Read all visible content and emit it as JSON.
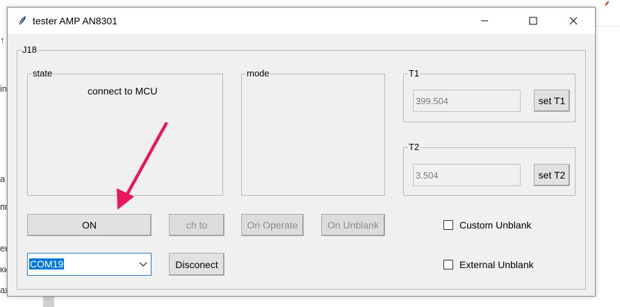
{
  "window": {
    "title": "tester AMP AN8301"
  },
  "groups": {
    "main": "J18",
    "state": "state",
    "mode": "mode",
    "t1": "T1",
    "t2": "T2"
  },
  "state_text": "connect to MCU",
  "t1": {
    "value": "399.504",
    "button": "set T1"
  },
  "t2": {
    "value": "3.504",
    "button": "set T2"
  },
  "buttons": {
    "on": "ON",
    "ch_to": "ch to",
    "on_operate": "On Operate",
    "on_unblank": "On Unblank",
    "disconnect": "Disconect"
  },
  "port": {
    "selected": "COM19"
  },
  "checkboxes": {
    "custom_unblank": {
      "label": "Custom Unblank",
      "checked": false
    },
    "external_unblank": {
      "label": "External Unblank",
      "checked": false
    }
  },
  "background_text": [
    "in",
    "a",
    "пп",
    "ен",
    "ки",
    "аж"
  ],
  "colors": {
    "arrow": "#e8195a",
    "selection": "#0078d7"
  }
}
